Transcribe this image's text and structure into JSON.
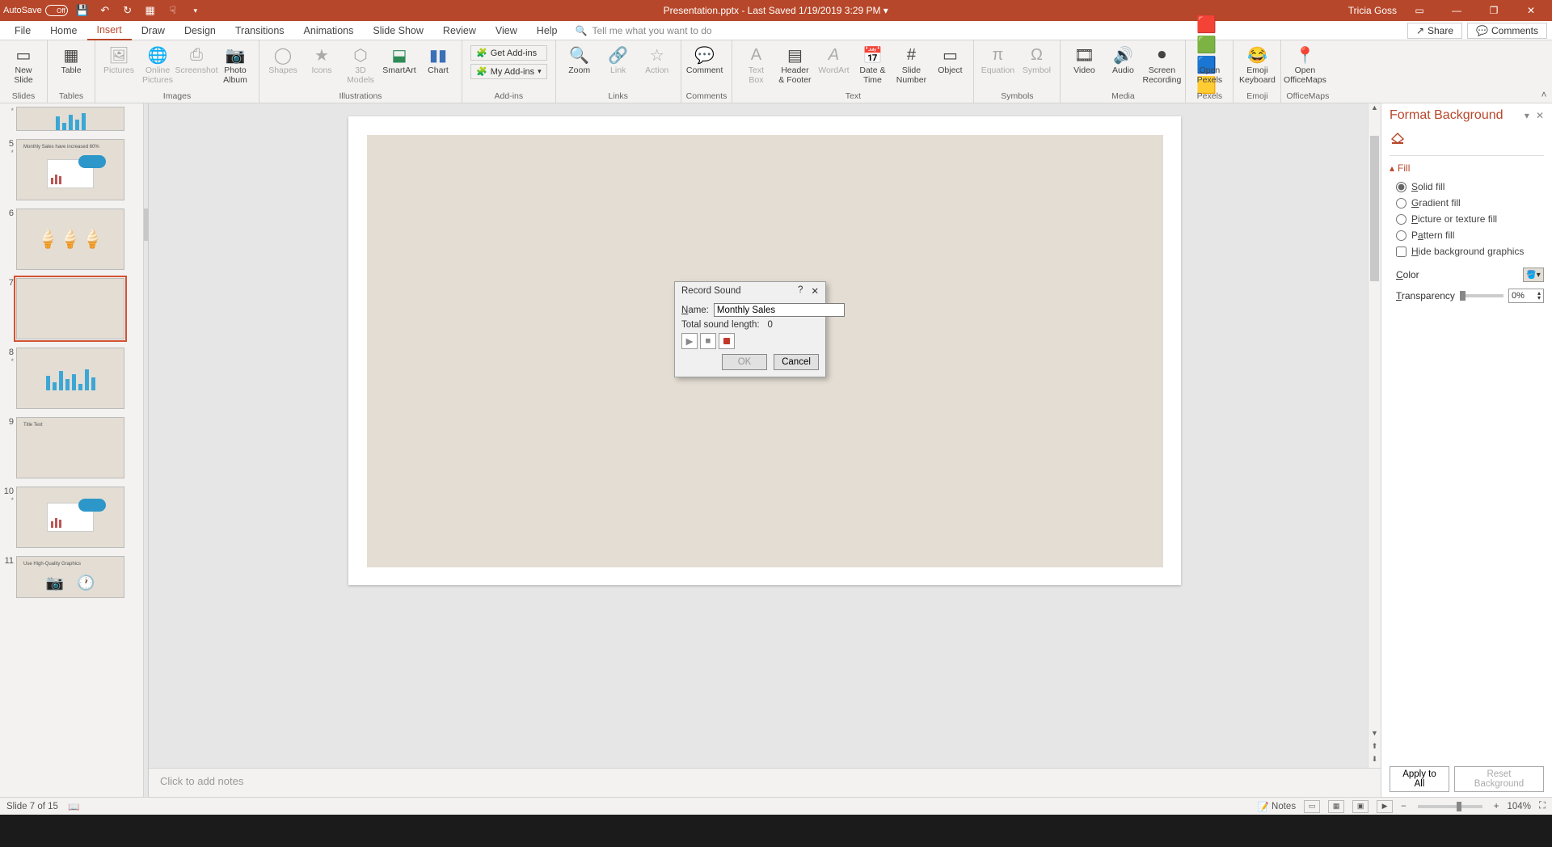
{
  "titleBar": {
    "autosave_label": "AutoSave",
    "autosave_state": "Off",
    "center": "Presentation.pptx  -  Last Saved 1/19/2019 3:29 PM  ▾",
    "user": "Tricia Goss"
  },
  "menu": {
    "tabs": [
      "File",
      "Home",
      "Insert",
      "Draw",
      "Design",
      "Transitions",
      "Animations",
      "Slide Show",
      "Review",
      "View",
      "Help"
    ],
    "active": "Insert",
    "tell_me_placeholder": "Tell me what you want to do",
    "share": "Share",
    "comments": "Comments"
  },
  "ribbon": {
    "groups": {
      "slides": {
        "label": "Slides",
        "new_slide": "New\nSlide"
      },
      "tables": {
        "label": "Tables",
        "table": "Table"
      },
      "images": {
        "label": "Images",
        "pictures": "Pictures",
        "online": "Online\nPictures",
        "screenshot": "Screenshot",
        "album": "Photo\nAlbum"
      },
      "illustrations": {
        "label": "Illustrations",
        "shapes": "Shapes",
        "icons": "Icons",
        "models": "3D\nModels",
        "smartart": "SmartArt",
        "chart": "Chart"
      },
      "addins": {
        "label": "Add-ins",
        "get": "Get Add-ins",
        "my": "My Add-ins"
      },
      "links": {
        "label": "Links",
        "zoom": "Zoom",
        "link": "Link",
        "action": "Action"
      },
      "comments": {
        "label": "Comments",
        "comment": "Comment"
      },
      "text": {
        "label": "Text",
        "textbox": "Text\nBox",
        "header": "Header\n& Footer",
        "wordart": "WordArt",
        "datetime": "Date &\nTime",
        "slidenum": "Slide\nNumber",
        "object": "Object"
      },
      "symbols": {
        "label": "Symbols",
        "equation": "Equation",
        "symbol": "Symbol"
      },
      "media": {
        "label": "Media",
        "video": "Video",
        "audio": "Audio",
        "recording": "Screen\nRecording"
      },
      "pexels": {
        "label": "Pexels",
        "open": "Open\nPexels"
      },
      "emoji": {
        "label": "Emoji",
        "open": "Emoji\nKeyboard"
      },
      "officemaps": {
        "label": "OfficeMaps",
        "open": "Open\nOfficeMaps"
      }
    }
  },
  "thumbs": [
    {
      "num": "",
      "star": "*"
    },
    {
      "num": "5",
      "star": "*",
      "caption": "Monthly Sales have increased 60%"
    },
    {
      "num": "6",
      "star": ""
    },
    {
      "num": "7",
      "star": "",
      "selected": true
    },
    {
      "num": "8",
      "star": "*"
    },
    {
      "num": "9",
      "star": "",
      "caption": "Title Text"
    },
    {
      "num": "10",
      "star": "*"
    },
    {
      "num": "11",
      "star": "",
      "caption": "Use High-Quality Graphics"
    }
  ],
  "notes": {
    "placeholder": "Click to add notes"
  },
  "formatPane": {
    "title": "Format Background",
    "section_fill": "Fill",
    "opt_solid": "Solid fill",
    "opt_gradient": "Gradient fill",
    "opt_picture": "Picture or texture fill",
    "opt_pattern": "Pattern fill",
    "opt_hidebg": "Hide background graphics",
    "color_label": "Color",
    "transparency_label": "Transparency",
    "transparency_value": "0%",
    "apply_all": "Apply to All",
    "reset": "Reset Background"
  },
  "dialog": {
    "title": "Record Sound",
    "name_label": "Name:",
    "name_value": "Monthly Sales",
    "length_label": "Total sound length:",
    "length_value": "0",
    "ok": "OK",
    "cancel": "Cancel"
  },
  "statusBar": {
    "slide_pos": "Slide 7 of 15",
    "notes_btn": "Notes",
    "zoom": "104%"
  }
}
